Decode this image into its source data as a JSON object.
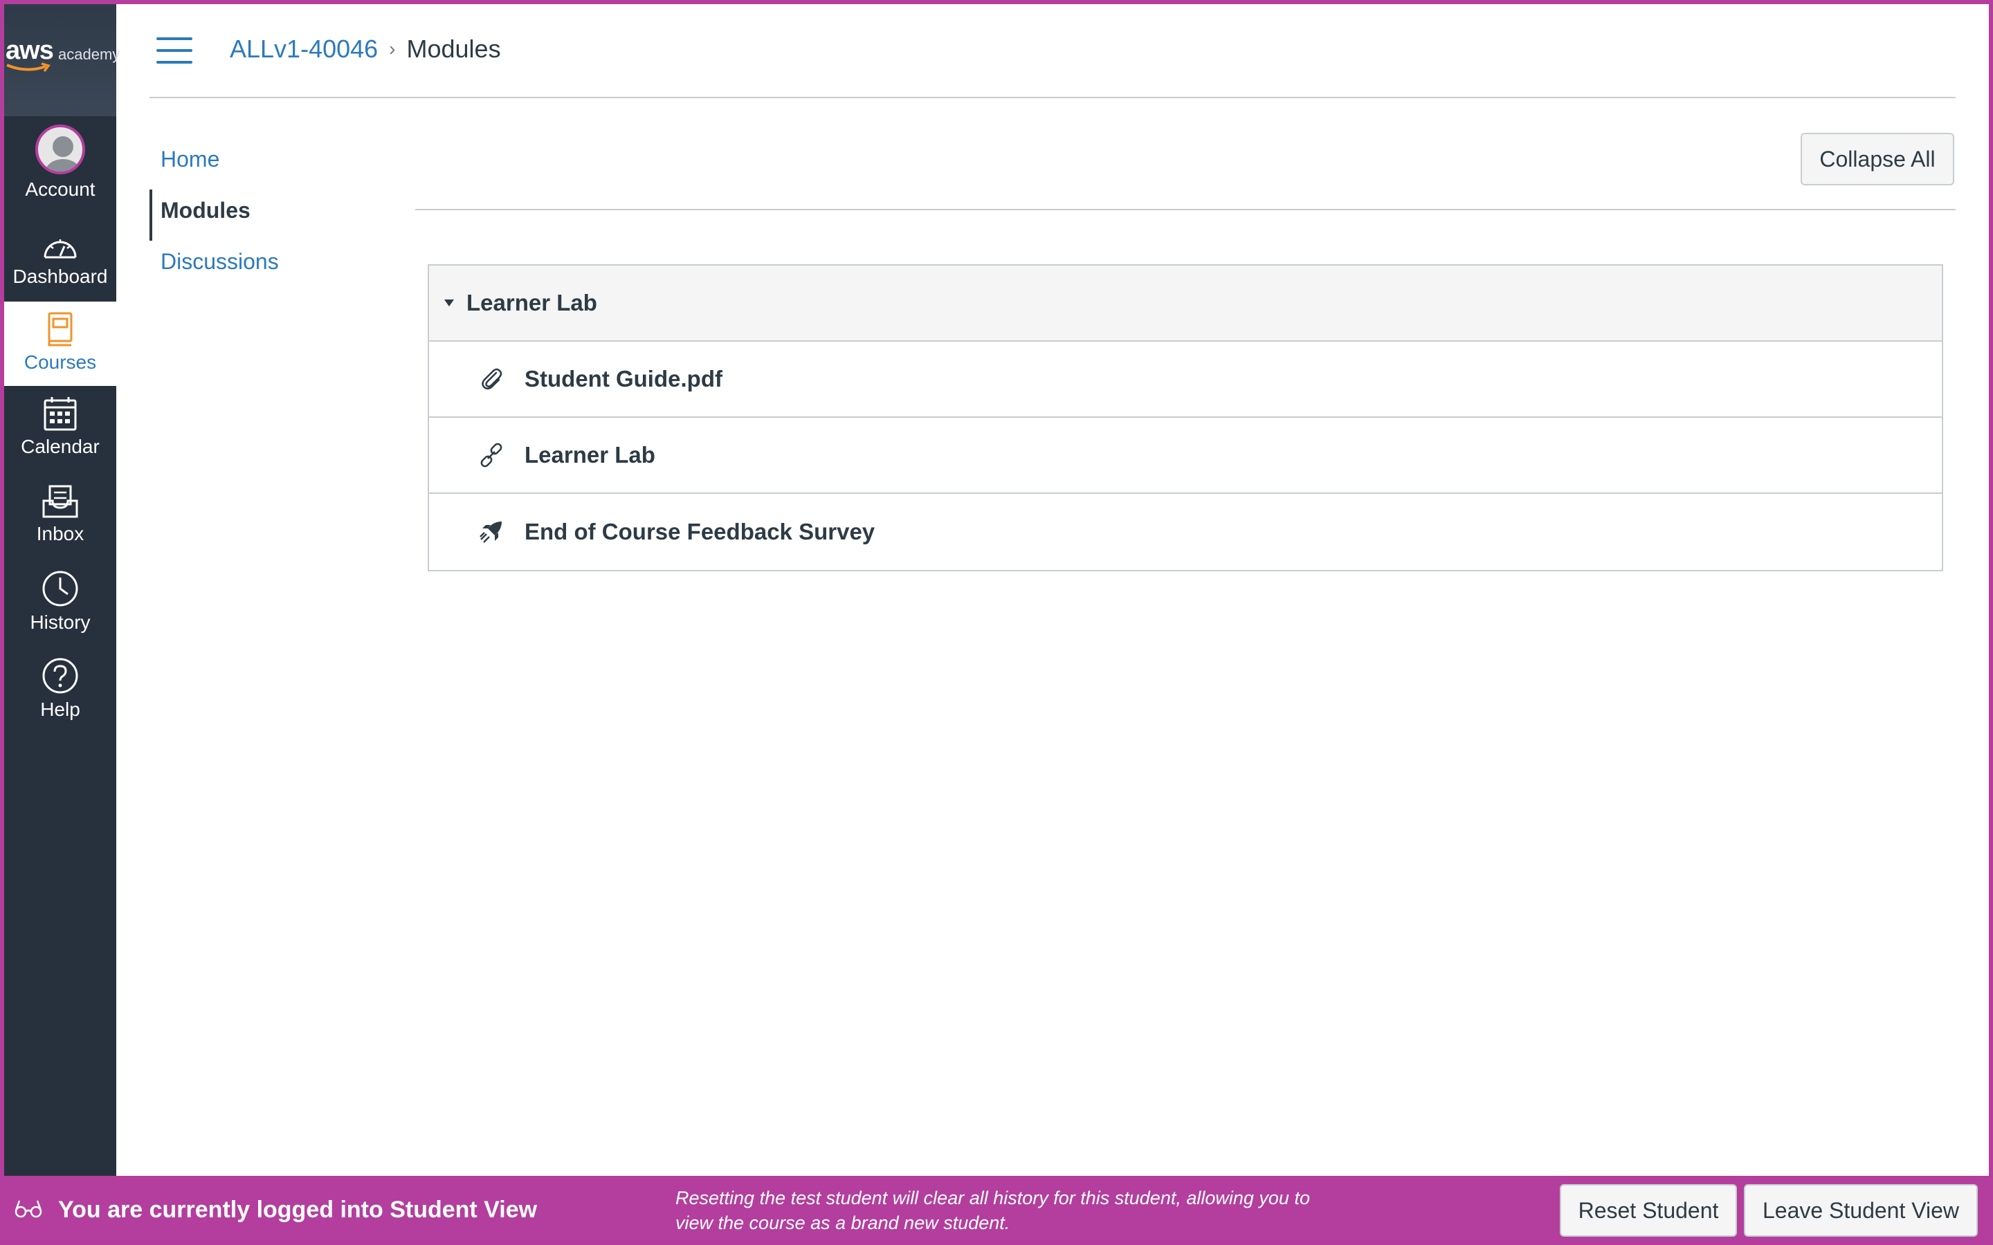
{
  "global_nav": {
    "logo_text": "aws",
    "logo_sub": "academy",
    "items": [
      {
        "label": "Account",
        "icon": "avatar-icon"
      },
      {
        "label": "Dashboard",
        "icon": "dashboard-icon"
      },
      {
        "label": "Courses",
        "icon": "courses-icon",
        "active": true
      },
      {
        "label": "Calendar",
        "icon": "calendar-icon"
      },
      {
        "label": "Inbox",
        "icon": "inbox-icon"
      },
      {
        "label": "History",
        "icon": "clock-icon"
      },
      {
        "label": "Help",
        "icon": "help-icon"
      }
    ]
  },
  "header": {
    "breadcrumb": {
      "course": "ALLv1-40046",
      "current": "Modules"
    }
  },
  "course_nav": {
    "items": [
      {
        "label": "Home"
      },
      {
        "label": "Modules",
        "active": true
      },
      {
        "label": "Discussions"
      }
    ]
  },
  "main": {
    "collapse_all_label": "Collapse All",
    "module": {
      "title": "Learner Lab",
      "items": [
        {
          "label": "Student Guide.pdf",
          "icon": "paperclip-icon"
        },
        {
          "label": "Learner Lab",
          "icon": "link-icon"
        },
        {
          "label": "End of Course Feedback Survey",
          "icon": "rocket-icon"
        }
      ]
    }
  },
  "student_view_bar": {
    "title": "You are currently logged into Student View",
    "note": "Resetting the test student will clear all history for this student, allowing you to view the course as a brand new student.",
    "reset_label": "Reset Student",
    "leave_label": "Leave Student View"
  },
  "colors": {
    "nav_bg": "#27303d",
    "accent": "#2b7abc",
    "student_view": "#b33e9d",
    "courses_icon": "#f0932b"
  }
}
